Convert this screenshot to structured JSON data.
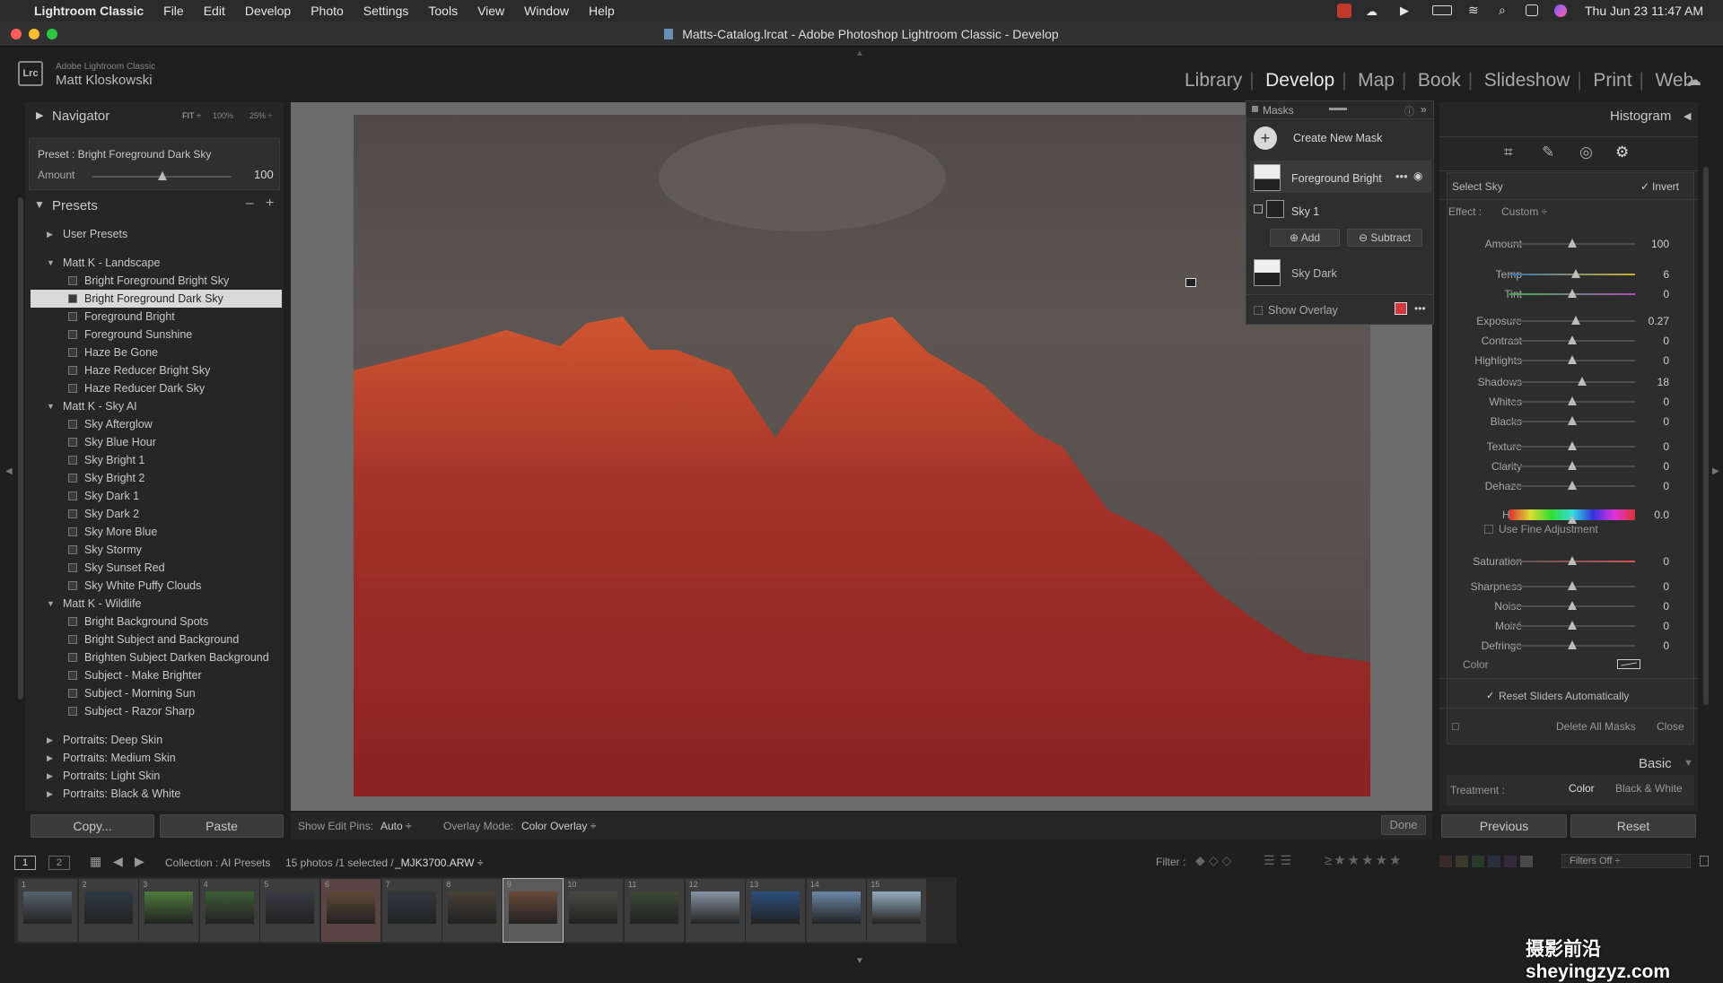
{
  "menubar": {
    "app": "Lightroom Classic",
    "items": [
      "File",
      "Edit",
      "Develop",
      "Photo",
      "Settings",
      "Tools",
      "View",
      "Window",
      "Help"
    ],
    "datetime": "Thu Jun 23  11:47 AM"
  },
  "window": {
    "title": "Matts-Catalog.lrcat - Adobe Photoshop Lightroom Classic - Develop"
  },
  "identity": {
    "badge": "Lrc",
    "product": "Adobe Lightroom Classic",
    "user": "Matt Kloskowski"
  },
  "modules": [
    "Library",
    "Develop",
    "Map",
    "Book",
    "Slideshow",
    "Print",
    "Web"
  ],
  "navigator": {
    "title": "Navigator",
    "zooms": [
      "FIT ÷",
      "100%",
      "25% ÷"
    ]
  },
  "preset_box": {
    "label": "Preset : Bright Foreground Dark Sky",
    "amount_label": "Amount",
    "amount_value": "100",
    "amount_fraction": 0.5
  },
  "presets": {
    "title": "Presets",
    "minus": "–",
    "plus": "+",
    "rows": [
      {
        "type": "folder",
        "label": "User Presets",
        "open": false
      },
      {
        "type": "gap"
      },
      {
        "type": "folder",
        "label": "Matt K - Landscape",
        "open": true
      },
      {
        "type": "preset",
        "label": "Bright Foreground Bright Sky"
      },
      {
        "type": "preset",
        "label": "Bright Foreground Dark Sky",
        "selected": true
      },
      {
        "type": "preset",
        "label": "Foreground Bright"
      },
      {
        "type": "preset",
        "label": "Foreground Sunshine"
      },
      {
        "type": "preset",
        "label": "Haze Be Gone"
      },
      {
        "type": "preset",
        "label": "Haze Reducer Bright Sky"
      },
      {
        "type": "preset",
        "label": "Haze Reducer Dark Sky"
      },
      {
        "type": "folder",
        "label": "Matt K - Sky AI",
        "open": true
      },
      {
        "type": "preset",
        "label": "Sky Afterglow"
      },
      {
        "type": "preset",
        "label": "Sky Blue Hour"
      },
      {
        "type": "preset",
        "label": "Sky Bright 1"
      },
      {
        "type": "preset",
        "label": "Sky Bright 2"
      },
      {
        "type": "preset",
        "label": "Sky Dark 1"
      },
      {
        "type": "preset",
        "label": "Sky Dark 2"
      },
      {
        "type": "preset",
        "label": "Sky More Blue"
      },
      {
        "type": "preset",
        "label": "Sky Stormy"
      },
      {
        "type": "preset",
        "label": "Sky Sunset Red"
      },
      {
        "type": "preset",
        "label": "Sky White Puffy Clouds"
      },
      {
        "type": "folder",
        "label": "Matt K - Wildlife",
        "open": true
      },
      {
        "type": "preset",
        "label": "Bright Background Spots"
      },
      {
        "type": "preset",
        "label": "Bright Subject and Background"
      },
      {
        "type": "preset",
        "label": "Brighten Subject Darken Background"
      },
      {
        "type": "preset",
        "label": "Subject - Make Brighter"
      },
      {
        "type": "preset",
        "label": "Subject - Morning Sun"
      },
      {
        "type": "preset",
        "label": "Subject - Razor Sharp"
      },
      {
        "type": "gap"
      },
      {
        "type": "folder",
        "label": "Portraits: Deep Skin",
        "open": false
      },
      {
        "type": "folder",
        "label": "Portraits: Medium Skin",
        "open": false
      },
      {
        "type": "folder",
        "label": "Portraits: Light Skin",
        "open": false
      },
      {
        "type": "folder",
        "label": "Portraits: Black & White",
        "open": false
      }
    ]
  },
  "left_buttons": {
    "copy": "Copy...",
    "paste": "Paste"
  },
  "toolbar": {
    "pins_label": "Show Edit Pins:",
    "pins_value": "Auto ÷",
    "overlay_label": "Overlay Mode:",
    "overlay_value": "Color Overlay ÷",
    "done": "Done"
  },
  "masks": {
    "title": "Masks",
    "create": "Create New Mask",
    "mask1": "Foreground Bright",
    "sub1": "Sky 1",
    "add": "Add",
    "subtract": "Subtract",
    "mask2": "Sky Dark",
    "show_overlay": "Show Overlay"
  },
  "right": {
    "histogram": "Histogram",
    "select": "Select Sky",
    "invert": "Invert",
    "effect_label": "Effect :",
    "effect_value": "Custom ÷",
    "sliders": [
      {
        "label": "Amount",
        "value": "100",
        "pos": 0.5
      },
      {
        "label": "Temp",
        "value": "6",
        "pos": 0.53
      },
      {
        "label": "Tint",
        "value": "0",
        "pos": 0.5
      },
      {
        "label": "Exposure",
        "value": "0.27",
        "pos": 0.53
      },
      {
        "label": "Contrast",
        "value": "0",
        "pos": 0.5
      },
      {
        "label": "Highlights",
        "value": "0",
        "pos": 0.5
      },
      {
        "label": "Shadows",
        "value": "18",
        "pos": 0.58
      },
      {
        "label": "Whites",
        "value": "0",
        "pos": 0.5
      },
      {
        "label": "Blacks",
        "value": "0",
        "pos": 0.5
      },
      {
        "label": "Texture",
        "value": "0",
        "pos": 0.5
      },
      {
        "label": "Clarity",
        "value": "0",
        "pos": 0.5
      },
      {
        "label": "Dehaze",
        "value": "0",
        "pos": 0.5
      },
      {
        "label": "Hue",
        "value": "0.0",
        "pos": 0.5
      },
      {
        "label": "Saturation",
        "value": "0",
        "pos": 0.5
      },
      {
        "label": "Sharpness",
        "value": "0",
        "pos": 0.5
      },
      {
        "label": "Noise",
        "value": "0",
        "pos": 0.5
      },
      {
        "label": "Moiré",
        "value": "0",
        "pos": 0.5
      },
      {
        "label": "Defringe",
        "value": "0",
        "pos": 0.5
      }
    ],
    "fine": "Use Fine Adjustment",
    "color_label": "Color",
    "reset_auto": "Reset Sliders Automatically",
    "delete_all": "Delete All Masks",
    "close": "Close",
    "basic": "Basic",
    "treatment_label": "Treatment :",
    "treatment_color": "Color",
    "treatment_bw": "Black & White",
    "previous": "Previous",
    "reset": "Reset"
  },
  "filmstrip": {
    "pages": [
      "1",
      "2"
    ],
    "source": "Collection : AI Presets",
    "count": "15 photos /1 selected /",
    "file": "_MJK3700.ARW ÷",
    "filter_label": "Filter :",
    "filters_off": "Filters Off ÷",
    "thumbs": [
      {
        "num": "1",
        "color": "#56626d"
      },
      {
        "num": "2",
        "color": "#2f3a46"
      },
      {
        "num": "3",
        "color": "#4f7b3b"
      },
      {
        "num": "4",
        "color": "#3f5c36"
      },
      {
        "num": "5",
        "color": "#3a3a44"
      },
      {
        "num": "6",
        "color": "#5d4a37"
      },
      {
        "num": "7",
        "color": "#33383f"
      },
      {
        "num": "8",
        "color": "#4a4037"
      },
      {
        "num": "9",
        "color": "#6a4a3a"
      },
      {
        "num": "10",
        "color": "#4a4a44"
      },
      {
        "num": "11",
        "color": "#3b4a35"
      },
      {
        "num": "12",
        "color": "#8794a3"
      },
      {
        "num": "13",
        "color": "#2b4f7c"
      },
      {
        "num": "14",
        "color": "#6b87a6"
      },
      {
        "num": "15",
        "color": "#93aac0"
      }
    ]
  },
  "watermark": "摄影前沿 sheyingzyz.com"
}
